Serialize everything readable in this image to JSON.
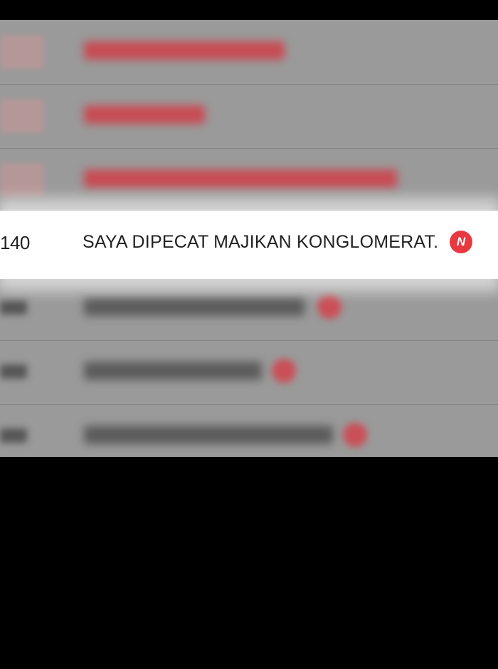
{
  "episode_list": {
    "highlighted": {
      "number": "140",
      "title": "SAYA DIPECAT MAJIKAN KONGLOMERAT.",
      "badge": "N"
    },
    "colors": {
      "accent": "#e83840",
      "panel": "#9a9a9a",
      "background": "#000000"
    }
  }
}
